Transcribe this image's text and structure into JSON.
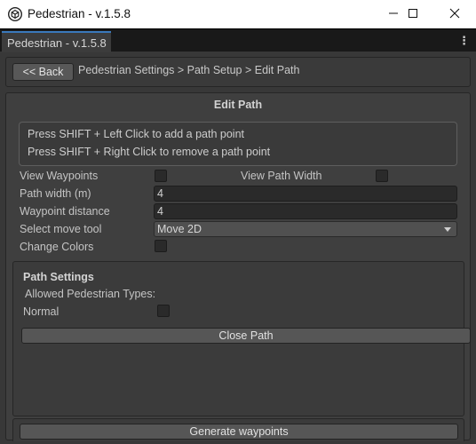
{
  "window": {
    "title": "Pedestrian - v.1.5.8",
    "app_icon": "unity-cube-icon",
    "controls": [
      "minimize-icon",
      "maximize-icon",
      "close-icon"
    ]
  },
  "tabbar": {
    "tab_label": "Pedestrian - v.1.5.8",
    "menu_icon": "kebab-menu-icon"
  },
  "breadcrumb": {
    "back_label": "<< Back",
    "path": "Pedestrian Settings > Path Setup > Edit Path"
  },
  "edit_path": {
    "title": "Edit Path",
    "help_lines": [
      "Press SHIFT + Left Click to add a path point",
      "Press SHIFT + Right Click to remove a path point"
    ],
    "view_waypoints_label": "View Waypoints",
    "view_waypoints_checked": false,
    "view_path_width_label": "View Path Width",
    "view_path_width_checked": false,
    "path_width_label": "Path width (m)",
    "path_width_value": "4",
    "waypoint_distance_label": "Waypoint distance",
    "waypoint_distance_value": "4",
    "move_tool_label": "Select move tool",
    "move_tool_value": "Move 2D",
    "change_colors_label": "Change Colors",
    "change_colors_checked": false
  },
  "path_settings": {
    "title": "Path Settings",
    "allowed_types_label": "Allowed Pedestrian Types:",
    "types": [
      {
        "label": "Normal",
        "checked": false
      }
    ],
    "close_path_label": "Close Path"
  },
  "generate_label": "Generate waypoints",
  "colors": {
    "background": "#383838",
    "panel": "#3f3f3f",
    "tab_accent": "#3a79bb"
  }
}
